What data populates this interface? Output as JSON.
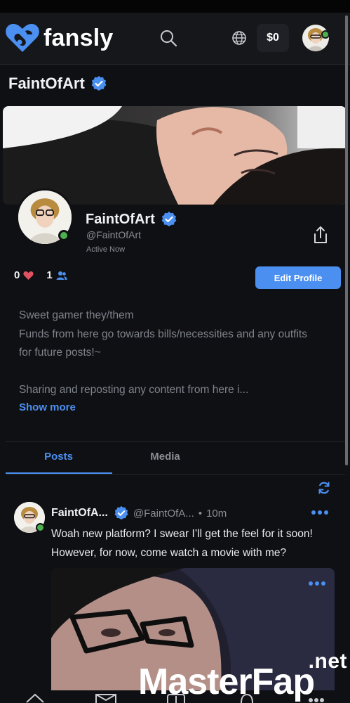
{
  "app": {
    "logo_text": "fansly",
    "brand_color": "#4b8ff0",
    "online_color": "#4caf50"
  },
  "topnav": {
    "search_icon": "search-icon",
    "language_icon": "globe-icon",
    "wallet_label": "$0"
  },
  "page": {
    "title": "FaintOfArt"
  },
  "profile": {
    "display_name": "FaintOfArt",
    "handle": "@FaintOfArt",
    "status": "Active Now",
    "likes": "0",
    "followers": "1",
    "edit_label": "Edit Profile",
    "bio_lines": [
      "Sweet gamer they/them",
      "Funds from here go towards bills/necessities and any outfits",
      "for future posts!~",
      "",
      "Sharing and reposting any content from here i..."
    ],
    "show_more": "Show more"
  },
  "tabs": [
    {
      "label": "Posts",
      "active": true
    },
    {
      "label": "Media",
      "active": false
    }
  ],
  "post": {
    "name": "FaintOfA...",
    "handle": "@FaintOfA...",
    "separator": "•",
    "time": "10m",
    "text_lines": [
      "Woah new platform? I swear I’ll get the feel for it soon!",
      "However, for now, come watch a movie with me?"
    ]
  },
  "watermark": {
    "suffix": ".net",
    "main": "MasterFap"
  }
}
